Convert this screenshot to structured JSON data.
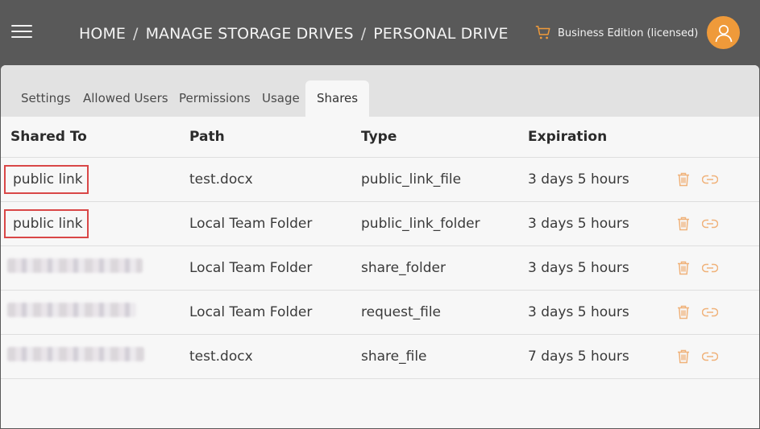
{
  "header": {
    "breadcrumb": [
      "HOME",
      "MANAGE STORAGE DRIVES",
      "PERSONAL DRIVE"
    ],
    "separator": "/",
    "edition": "Business Edition (licensed)",
    "icons": {
      "menu": "hamburger-menu-icon",
      "cart": "cart-icon",
      "user": "user-avatar-icon"
    }
  },
  "tabs": [
    "Settings",
    "Allowed Users",
    "Permissions",
    "Usage",
    "Shares"
  ],
  "active_tab": "Shares",
  "table": {
    "columns": [
      "Shared To",
      "Path",
      "Type",
      "Expiration"
    ],
    "rows": [
      {
        "shared_to": "public link",
        "path": "test.docx",
        "type": "public_link_file",
        "expiration": "3 days 5 hours"
      },
      {
        "shared_to": "public link",
        "path": "Local Team Folder",
        "type": "public_link_folder",
        "expiration": "3 days 5 hours"
      },
      {
        "shared_to": "",
        "path": "Local Team Folder",
        "type": "share_folder",
        "expiration": "3 days 5 hours"
      },
      {
        "shared_to": "",
        "path": "Local Team Folder",
        "type": "request_file",
        "expiration": "3 days 5 hours"
      },
      {
        "shared_to": "",
        "path": "test.docx",
        "type": "share_file",
        "expiration": "7 days 5 hours"
      }
    ],
    "row_icons": [
      "trash-icon",
      "link-icon"
    ]
  },
  "colors": {
    "header_bg": "#595959",
    "accent": "#ef9a3a",
    "highlight_border": "#d94747"
  }
}
